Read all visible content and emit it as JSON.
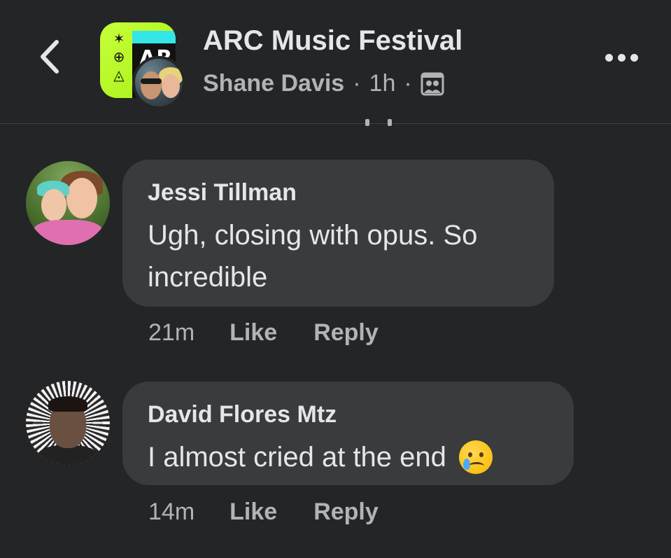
{
  "header": {
    "title": "ARC Music Festival",
    "poster_name": "Shane Davis",
    "separator": "·",
    "time_ago": "1h",
    "audience_icon": "group-members-icon",
    "group_avatar_text": "AR",
    "group_avatar_glyphs": [
      "✶",
      "⊕",
      "◬"
    ],
    "back_icon": "chevron-left-icon",
    "more_icon": "more-horizontal-icon"
  },
  "comments": [
    {
      "author": "Jessi Tillman",
      "text": "Ugh, closing with opus. So incredible",
      "time": "21m",
      "like_label": "Like",
      "reply_label": "Reply"
    },
    {
      "author": "David Flores Mtz",
      "text": "I almost cried at the end",
      "emoji": "smiling-face-with-tear",
      "time": "14m",
      "like_label": "Like",
      "reply_label": "Reply"
    }
  ],
  "colors": {
    "background": "#242526",
    "bubble": "#3a3b3c",
    "primary_text": "#e4e6eb",
    "secondary_text": "#b0b3b8",
    "group_avatar_accent": "#c7ff3a"
  }
}
